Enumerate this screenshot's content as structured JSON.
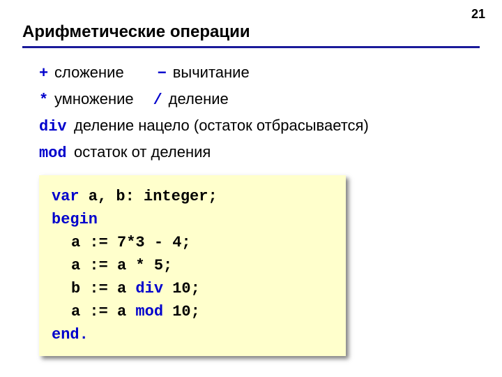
{
  "page_number": "21",
  "title": "Арифметические операции",
  "ops": {
    "plus_sym": "+",
    "plus_desc": "сложение",
    "minus_sym": "−",
    "minus_desc": "вычитание",
    "mul_sym": "*",
    "mul_desc": "умножение",
    "div_sym": "/",
    "div_desc": "деление",
    "divkw": "div",
    "divkw_desc": "деление нацело (остаток отбрасывается)",
    "modkw": "mod",
    "modkw_desc": "остаток от деления"
  },
  "code": {
    "kw_var": "var",
    "var_rest": " a, b: integer;",
    "kw_begin": "begin",
    "l1": "a := 7*3 - 4;",
    "l2": "a := a * 5;",
    "l3_pre": "b := a ",
    "l3_kw": "div",
    "l3_post": " 10;",
    "l4_pre": "a := a ",
    "l4_kw": "mod",
    "l4_post": " 10;",
    "kw_end": "end."
  }
}
